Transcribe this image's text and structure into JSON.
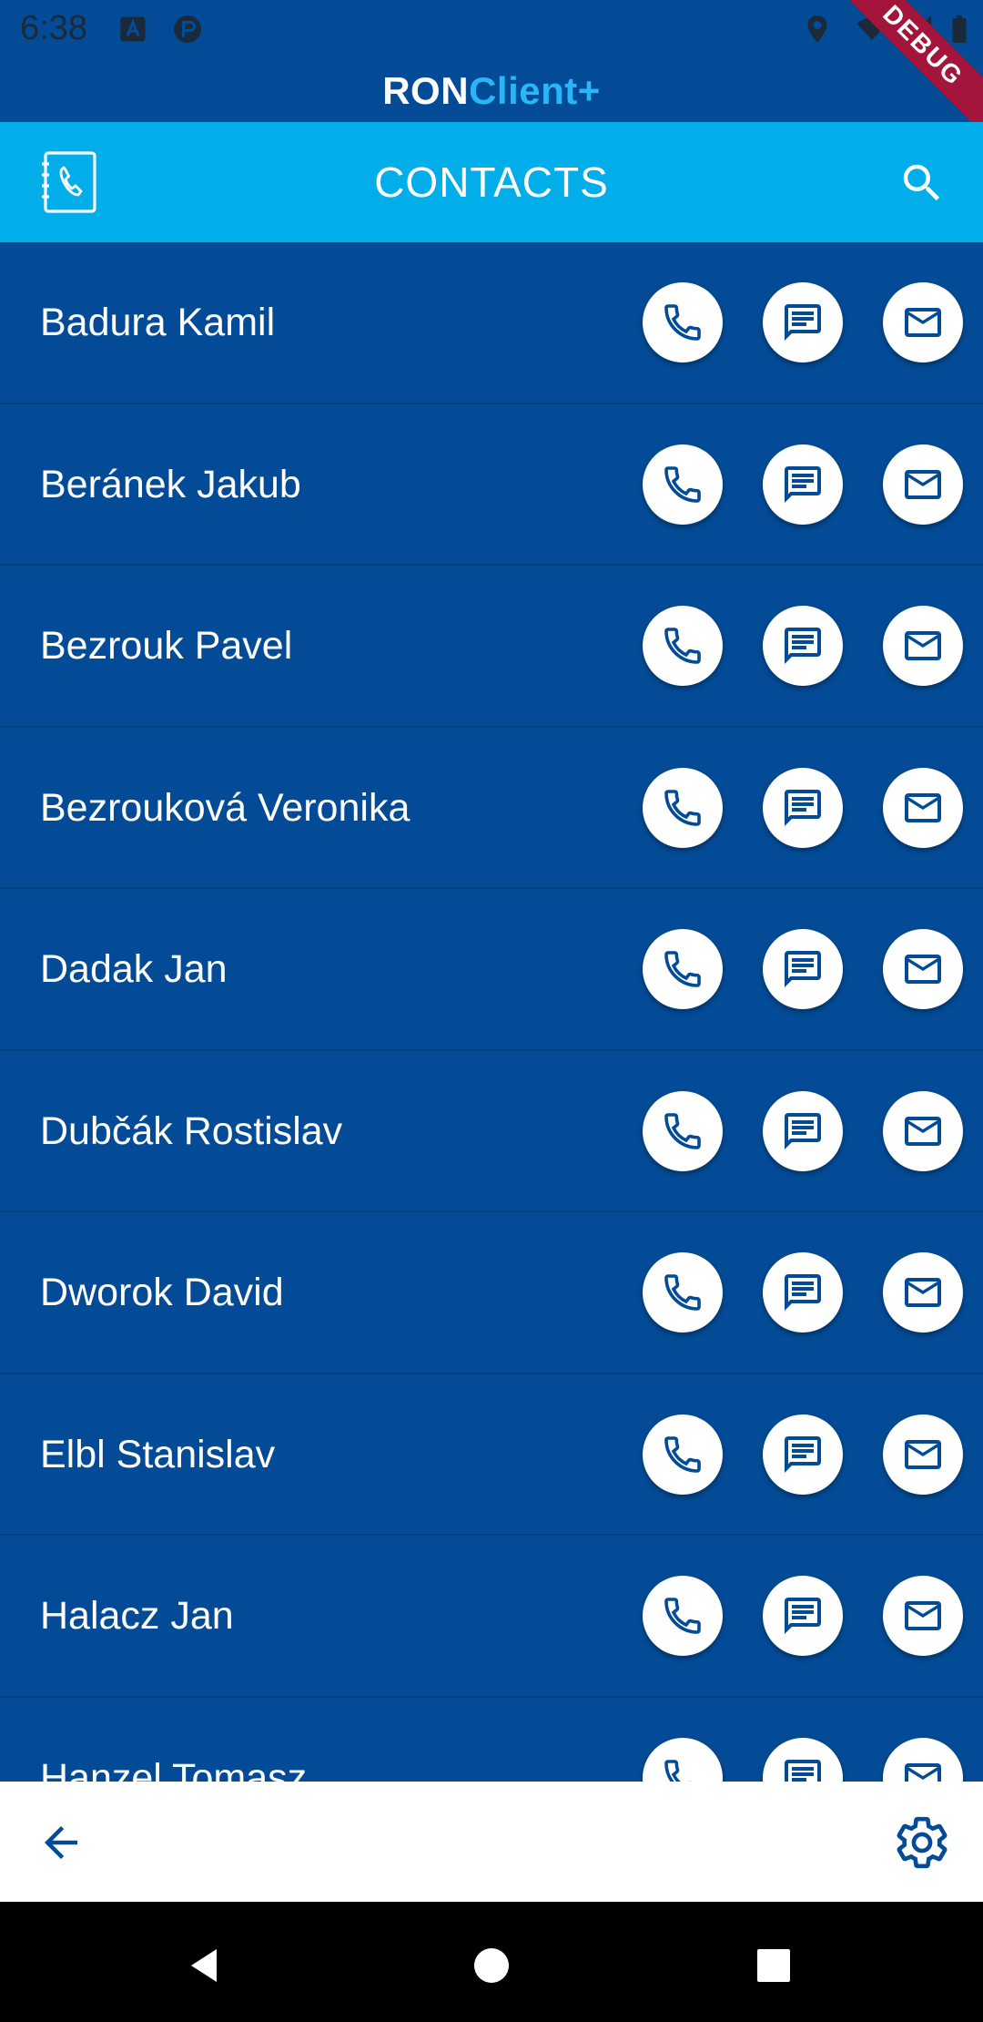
{
  "status_bar": {
    "time": "6:38",
    "icons": [
      "a-notification-icon",
      "app-notification-icon",
      "location-icon",
      "wifi-icon",
      "signal-icon",
      "battery-icon"
    ]
  },
  "brand": {
    "part1": "RON",
    "part2": "Client+"
  },
  "debug_banner": "DEBUG",
  "app_bar": {
    "title": "CONTACTS",
    "left_icon": "contacts-book-icon",
    "right_icon": "search-icon"
  },
  "contacts": [
    {
      "name": "Badura Kamil"
    },
    {
      "name": "Beránek Jakub"
    },
    {
      "name": "Bezrouk Pavel"
    },
    {
      "name": "Bezrouková Veronika"
    },
    {
      "name": "Dadak Jan"
    },
    {
      "name": "Dubčák Rostislav"
    },
    {
      "name": "Dworok David"
    },
    {
      "name": "Elbl Stanislav"
    },
    {
      "name": "Halacz Jan"
    },
    {
      "name": "Hanzel Tomasz"
    }
  ],
  "row_actions": [
    "phone-icon",
    "message-icon",
    "mail-icon"
  ],
  "bottom_bar": {
    "left_icon": "arrow-back-icon",
    "right_icon": "gear-icon"
  },
  "nav_bar": [
    "nav-back-icon",
    "nav-home-icon",
    "nav-recents-icon"
  ],
  "colors": {
    "background": "#034b96",
    "app_bar": "#02aeea",
    "brand_accent": "#29b6f6",
    "button_fill": "#ffffff",
    "icon_color": "#034b96",
    "debug": "#a3153a"
  }
}
